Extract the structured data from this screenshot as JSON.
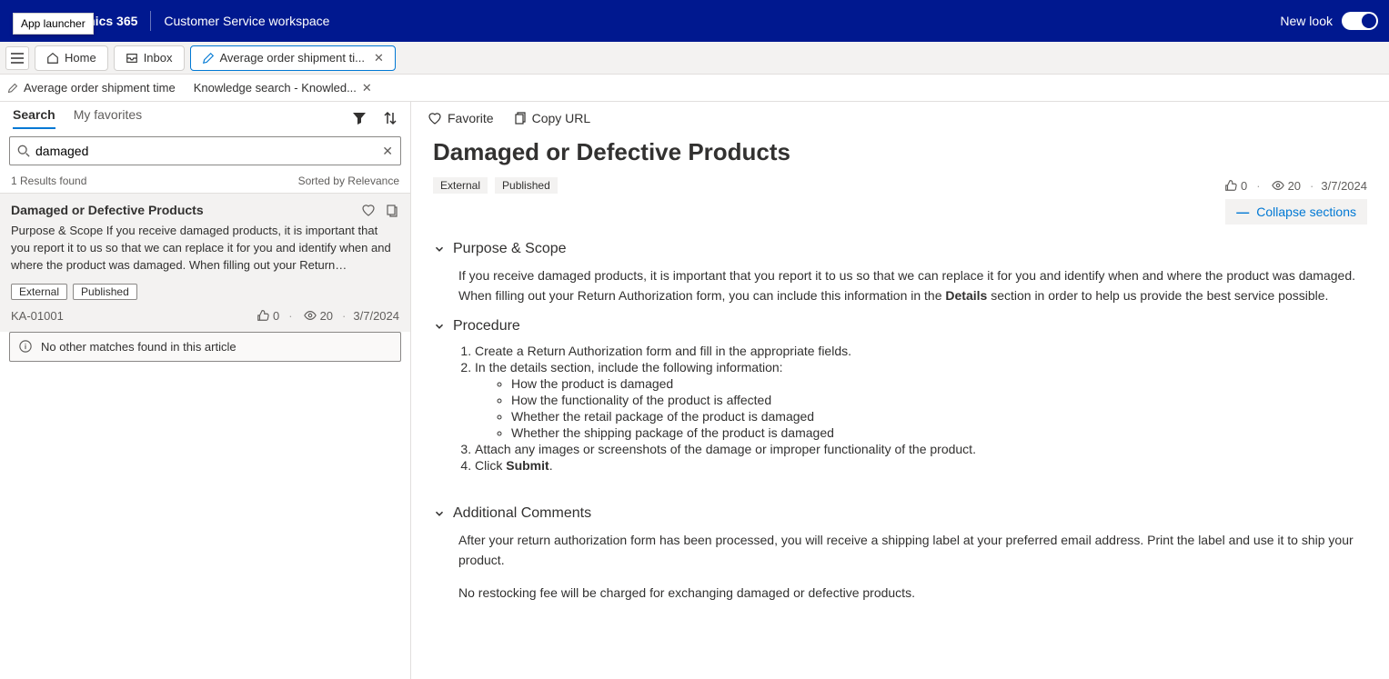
{
  "topbar": {
    "app_launcher_tooltip": "App launcher",
    "brand": "Dynamics 365",
    "workspace": "Customer Service workspace",
    "new_look_label": "New look"
  },
  "tabs": {
    "home": "Home",
    "inbox": "Inbox",
    "case": "Average order shipment ti..."
  },
  "subtabs": {
    "case": "Average order shipment time",
    "ksearch": "Knowledge search - Knowled..."
  },
  "left": {
    "tab_search": "Search",
    "tab_favorites": "My favorites",
    "search_value": "damaged",
    "results_found": "1 Results found",
    "sorted_by": "Sorted by Relevance",
    "result": {
      "title": "Damaged or Defective Products",
      "snippet": "Purpose & Scope If you receive damaged products, it is important that you report it to us so that we can replace it for you and identify when and where the product was damaged. When filling out your Return…",
      "tag_external": "External",
      "tag_published": "Published",
      "article_number": "KA-01001",
      "likes": "0",
      "views": "20",
      "date": "3/7/2024"
    },
    "no_other": "No other matches found in this article"
  },
  "right": {
    "favorite": "Favorite",
    "copy_url": "Copy URL",
    "title": "Damaged or Defective Products",
    "tag_external": "External",
    "tag_published": "Published",
    "likes": "0",
    "views": "20",
    "date": "3/7/2024",
    "collapse": "Collapse sections",
    "s1_head": "Purpose & Scope",
    "s1_p_a": "If you receive damaged products, it is important that you report it to us so that we can replace it for you and identify when and where the product was damaged. When filling out your Return Authorization form, you can include this information in the ",
    "s1_bold": "Details",
    "s1_p_b": " section in order to help us provide the best service possible.",
    "s2_head": "Procedure",
    "s2_1": "Create a Return Authorization form and fill in the appropriate fields.",
    "s2_2": "In the details section, include the following information:",
    "s2_2a": "How the product is damaged",
    "s2_2b": "How the functionality of the product is affected",
    "s2_2c": "Whether the retail package of the product is damaged",
    "s2_2d": "Whether the shipping package of the product is damaged",
    "s2_3": "Attach any images or screenshots of the damage or improper functionality of the product.",
    "s2_4a": "Click ",
    "s2_4b": "Submit",
    "s2_4c": ".",
    "s3_head": "Additional Comments",
    "s3_p1": "After your return authorization form has been processed, you will receive a shipping label at your preferred email address. Print the label and use it to ship your product.",
    "s3_p2": "No restocking fee will be charged for exchanging damaged or defective products."
  }
}
